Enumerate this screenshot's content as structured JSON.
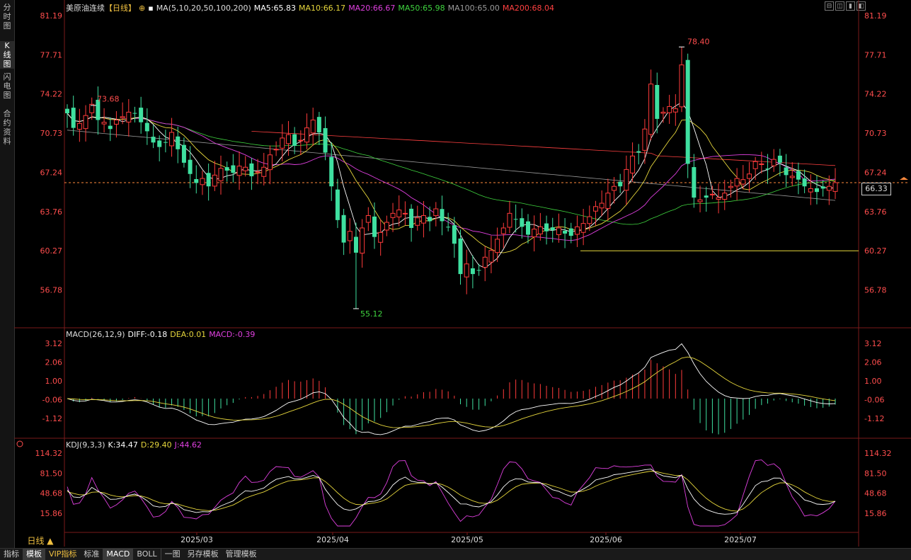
{
  "sidebar": {
    "tabs": [
      {
        "label": "分时图",
        "active": false
      },
      {
        "label": "K线图",
        "active": true
      },
      {
        "label": "闪电图",
        "active": false
      },
      {
        "label": "合约资料",
        "active": false
      }
    ]
  },
  "header": {
    "symbol": "美原油连续",
    "period_tag": "【日线】",
    "ma_params": "MA(5,10,20,50,100,200)",
    "ma_values": [
      {
        "text": "MA5:65.83",
        "color": "#ffffff"
      },
      {
        "text": "MA10:66.17",
        "color": "#e6d63c"
      },
      {
        "text": "MA20:66.67",
        "color": "#e040e0"
      },
      {
        "text": "MA50:65.98",
        "color": "#3fd43f"
      },
      {
        "text": "MA100:65.00",
        "color": "#9a9a9a"
      },
      {
        "text": "MA200:68.04",
        "color": "#ff4040"
      }
    ]
  },
  "window_buttons": [
    "⊟",
    "◫",
    "▮",
    "◧"
  ],
  "price_axis": {
    "ticks": [
      "81.19",
      "77.71",
      "74.22",
      "70.73",
      "67.24",
      "63.76",
      "60.27",
      "56.78"
    ],
    "current_price": "66.33",
    "high_label": "78.40",
    "low_label": "55.12",
    "left_peak_label": "73.68"
  },
  "macd": {
    "title": "MACD(26,12,9)",
    "diff": "DIFF:-0.18",
    "dea": "DEA:0.01",
    "macd": "MACD:-0.39",
    "ticks": [
      "3.12",
      "2.06",
      "1.00",
      "-0.06",
      "-1.12"
    ]
  },
  "kdj": {
    "title": "KDJ(9,3,3)",
    "k": "K:34.47",
    "d": "D:29.40",
    "j": "J:44.62",
    "ticks": [
      "114.32",
      "81.50",
      "48.68",
      "15.86"
    ]
  },
  "x_axis": {
    "labels": [
      "2025/03",
      "2025/04",
      "2025/05",
      "2025/06",
      "2025/07"
    ]
  },
  "period_selector": "日线 ▲",
  "bottom_tabs": [
    {
      "label": "指标",
      "active": false
    },
    {
      "label": "模板",
      "active": true
    },
    {
      "label": "VIP指标",
      "active": false
    },
    {
      "label": "标准",
      "active": false
    },
    {
      "label": "MACD",
      "active": true
    },
    {
      "label": "BOLL",
      "active": false
    },
    {
      "label": "一图",
      "active": false
    },
    {
      "label": "另存模板",
      "active": false
    },
    {
      "label": "管理模板",
      "active": false
    }
  ],
  "colors": {
    "up": "#ff3b3b",
    "down": "#3fe0a0",
    "ma5": "#ffffff",
    "ma10": "#e6d63c",
    "ma20": "#e040e0",
    "ma50": "#3fd43f",
    "ma100": "#9a9a9a",
    "ma200": "#ff4040"
  },
  "chart_data": {
    "type": "candlestick",
    "price_axis_range": [
      55.12,
      81.19
    ],
    "support_level": 60.27,
    "current_price_line": 66.33,
    "closes": [
      72.5,
      71.2,
      71.6,
      72.3,
      73.3,
      71.9,
      71.7,
      71.1,
      71.9,
      72.2,
      72.6,
      72.5,
      71.7,
      70.9,
      69.9,
      69.5,
      69.9,
      70.8,
      69.3,
      68.1,
      67.1,
      66.3,
      66.7,
      66.0,
      67.0,
      67.6,
      67.4,
      67.2,
      67.8,
      67.7,
      66.9,
      67.3,
      67.7,
      68.8,
      69.3,
      70.3,
      70.6,
      69.6,
      70.1,
      71.2,
      71.9,
      70.8,
      69.0,
      66.0,
      63.0,
      61.0,
      62.0,
      60.1,
      62.3,
      63.4,
      61.5,
      61.9,
      62.8,
      63.6,
      63.9,
      63.6,
      62.3,
      63.2,
      63.4,
      62.9,
      64.0,
      62.9,
      62.4,
      60.9,
      58.2,
      59.1,
      58.2,
      58.5,
      59.7,
      60.3,
      61.3,
      62.3,
      63.6,
      63.1,
      62.4,
      61.7,
      62.2,
      62.4,
      62.0,
      62.1,
      62.3,
      61.8,
      61.6,
      62.4,
      62.7,
      63.3,
      64.2,
      64.5,
      65.4,
      66.0,
      66.0,
      67.5,
      68.7,
      69.0,
      71.1,
      75.1,
      72.0,
      72.6,
      73.1,
      72.9,
      76.8,
      68.0,
      65.0,
      64.8,
      65.0,
      65.3,
      65.0,
      65.4,
      66.0,
      66.7,
      66.6,
      67.1,
      68.2,
      68.0,
      67.5,
      68.4,
      68.1,
      67.0,
      66.9,
      66.6,
      66.0,
      65.8,
      65.5,
      65.8,
      66.0,
      66.33
    ],
    "high_point": {
      "value": 78.4
    },
    "low_point": {
      "value": 55.12
    }
  }
}
